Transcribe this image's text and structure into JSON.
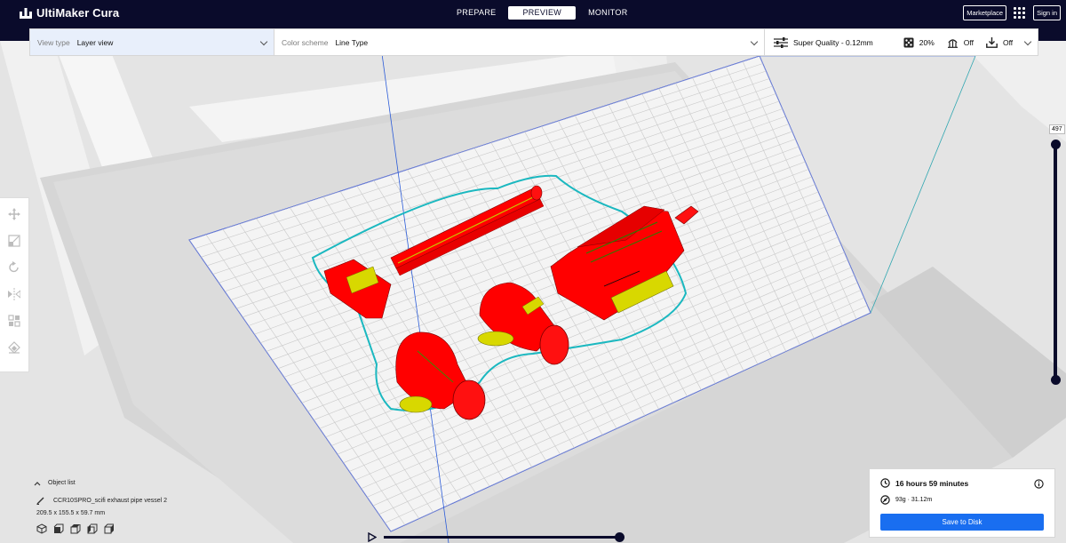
{
  "app": {
    "name": "UltiMaker Cura"
  },
  "stages": [
    {
      "label": "PREPARE",
      "active": false
    },
    {
      "label": "PREVIEW",
      "active": true
    },
    {
      "label": "MONITOR",
      "active": false
    }
  ],
  "header_right": {
    "marketplace": "Marketplace",
    "signin": "Sign in"
  },
  "toolbar": {
    "view_type_label": "View type",
    "view_type_value": "Layer view",
    "color_scheme_label": "Color scheme",
    "color_scheme_value": "Line Type",
    "profile": "Super Quality - 0.12mm",
    "infill": "20%",
    "support": "Off",
    "adhesion": "Off"
  },
  "layer_slider": {
    "value": "497"
  },
  "object_list": {
    "header": "Object list",
    "object_name": "CCR10SPRO_scifi exhaust pipe vessel 2",
    "dimensions": "209.5 x 155.5 x 59.7 mm"
  },
  "print_info": {
    "time": "16 hours 59 minutes",
    "material": "93g · 31.12m",
    "save_label": "Save to Disk"
  },
  "colors": {
    "header_bg": "#0a0b2b",
    "accent_blue": "#196ef0",
    "model_red": "#ff0000",
    "infill_yellow": "#e8e800",
    "skirt_cyan": "#00c8c8"
  }
}
